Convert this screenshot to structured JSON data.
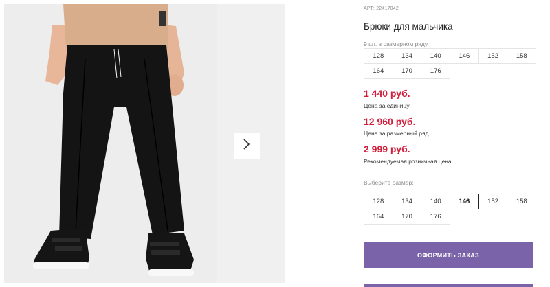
{
  "product": {
    "sku": "АРТ: 22417042",
    "title": "Брюки для мальчика"
  },
  "pack": {
    "label": "9 шт. в размерном ряду",
    "sizes": [
      "128",
      "134",
      "140",
      "146",
      "152",
      "158",
      "164",
      "170",
      "176"
    ]
  },
  "prices": {
    "unit_price": "1 440 руб.",
    "unit_label": "Цена за единицу",
    "pack_price": "12 960 руб.",
    "pack_label": "Цена за размерный ряд",
    "retail_price": "2 999 руб.",
    "retail_label": "Рекомендуемая розничная цена"
  },
  "size_select": {
    "label": "Выберите размер:",
    "sizes": [
      "128",
      "134",
      "140",
      "146",
      "152",
      "158",
      "164",
      "170",
      "176"
    ],
    "selected": "146"
  },
  "actions": {
    "order_label": "ОФОРМИТЬ ЗАКАЗ"
  },
  "gallery": {
    "next_icon": "chevron-right-icon"
  },
  "colors": {
    "accent": "#7a63a8",
    "price": "#d01f3c"
  }
}
